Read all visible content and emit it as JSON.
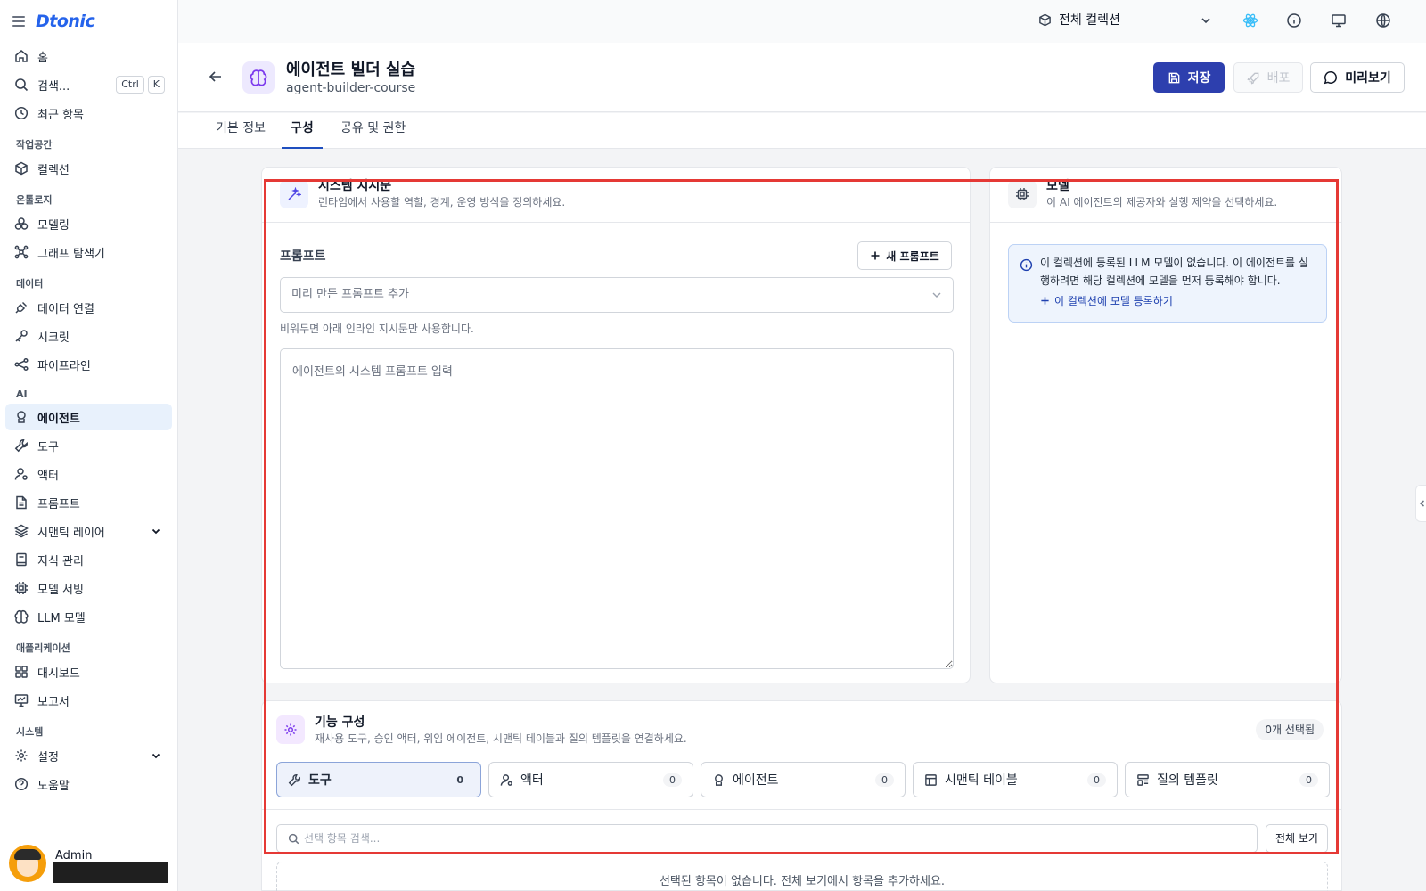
{
  "brand": {
    "logo": "Dtonic"
  },
  "sidebar": {
    "home": "홈",
    "search": "검색...",
    "search_kbd": [
      "Ctrl",
      "K"
    ],
    "recent": "최근 항목",
    "sections": {
      "workspace": "작업공간",
      "ontology": "온톨로지",
      "data": "데이터",
      "ai": "AI",
      "apps": "애플리케이션",
      "system": "시스템"
    },
    "items": {
      "collection": "컬렉션",
      "modeling": "모델링",
      "graph": "그래프 탐색기",
      "data_conn": "데이터 연결",
      "secret": "시크릿",
      "pipeline": "파이프라인",
      "agent": "에이전트",
      "tool": "도구",
      "actor": "액터",
      "prompt": "프롬프트",
      "semantic": "시맨틱 레이어",
      "knowledge": "지식 관리",
      "serving": "모델 서빙",
      "llm": "LLM 모델",
      "dashboard": "대시보드",
      "report": "보고서",
      "settings": "설정",
      "help": "도움말"
    },
    "user": {
      "name": "Admin"
    }
  },
  "topbar": {
    "collection": "전체 컬렉션"
  },
  "header": {
    "title": "에이전트 빌더 실습",
    "slug": "agent-builder-course",
    "save": "저장",
    "deploy": "배포",
    "preview": "미리보기"
  },
  "tabs": [
    "기본 정보",
    "구성",
    "공유 및 권한"
  ],
  "system_card": {
    "title": "시스템 지시문",
    "desc": "런타임에서 사용할 역할, 경계, 운영 방식을 정의하세요.",
    "prompt_label": "프롬프트",
    "new_prompt": "새 프롬프트",
    "select_placeholder": "미리 만든 프롬프트 추가",
    "hint": "비워두면 아래 인라인 지시문만 사용합니다.",
    "textarea_placeholder": "에이전트의 시스템 프롬프트 입력"
  },
  "model_card": {
    "title": "모델",
    "desc": "이 AI 에이전트의 제공자와 실행 제약을 선택하세요.",
    "alert": "이 컬렉션에 등록된 LLM 모델이 없습니다. 이 에이전트를 실행하려면 해당 컬렉션에 모델을 먼저 등록해야 합니다.",
    "alert_link": "이 컬렉션에 모델 등록하기"
  },
  "feature_card": {
    "title": "기능 구성",
    "desc": "재사용 도구, 승인 액터, 위임 에이전트, 시맨틱 테이블과 질의 템플릿을 연결하세요.",
    "selected": "0개 선택됨",
    "tabs": [
      {
        "label": "도구",
        "count": "0"
      },
      {
        "label": "액터",
        "count": "0"
      },
      {
        "label": "에이전트",
        "count": "0"
      },
      {
        "label": "시맨틱 테이블",
        "count": "0"
      },
      {
        "label": "질의 템플릿",
        "count": "0"
      }
    ],
    "search_placeholder": "선택 항목 검색...",
    "view_all": "전체 보기",
    "empty": "선택된 항목이 없습니다. 전체 보기에서 항목을 추가하세요."
  },
  "colors": {
    "primary": "#2d3fae",
    "highlight": "#e53935",
    "active_nav": "#e8f1fc"
  }
}
